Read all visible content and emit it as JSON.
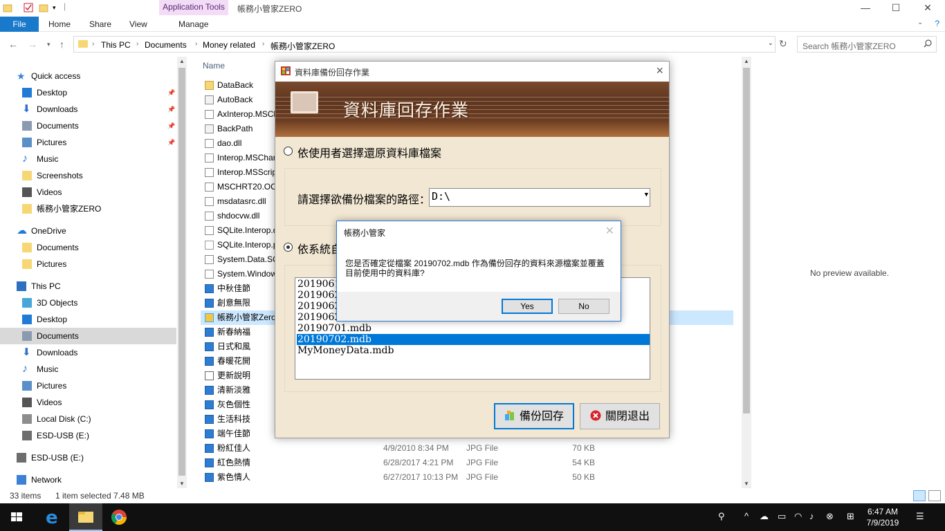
{
  "window": {
    "title": "帳務小管家ZERO",
    "app_tools": "Application Tools",
    "controls": {
      "minimize": "—",
      "maximize": "☐",
      "close": "✕"
    }
  },
  "ribbon": {
    "tabs": [
      "File",
      "Home",
      "Share",
      "View",
      "Manage"
    ]
  },
  "address": {
    "crumbs": [
      "This PC",
      "Documents",
      "Money related",
      "帳務小管家ZERO"
    ],
    "search_placeholder": "Search 帳務小管家ZERO"
  },
  "nav": {
    "items": [
      {
        "label": "Quick access",
        "icon": "star-icon",
        "pinned": false
      },
      {
        "label": "Desktop",
        "icon": "desktop-icon",
        "pinned": true
      },
      {
        "label": "Downloads",
        "icon": "download-icon",
        "pinned": true
      },
      {
        "label": "Documents",
        "icon": "documents-icon",
        "pinned": true
      },
      {
        "label": "Pictures",
        "icon": "pictures-icon",
        "pinned": true
      },
      {
        "label": "Music",
        "icon": "music-icon",
        "pinned": false
      },
      {
        "label": "Screenshots",
        "icon": "folder-icon",
        "pinned": false
      },
      {
        "label": "Videos",
        "icon": "videos-icon",
        "pinned": false
      },
      {
        "label": "帳務小管家ZERO",
        "icon": "folder-icon",
        "pinned": false
      },
      {
        "label": "OneDrive",
        "icon": "cloud-icon",
        "pinned": false
      },
      {
        "label": "Documents",
        "icon": "folder-icon",
        "pinned": false
      },
      {
        "label": "Pictures",
        "icon": "folder-icon",
        "pinned": false
      },
      {
        "label": "This PC",
        "icon": "computer-icon",
        "pinned": false
      },
      {
        "label": "3D Objects",
        "icon": "cube-icon",
        "pinned": false
      },
      {
        "label": "Desktop",
        "icon": "desktop-icon",
        "pinned": false
      },
      {
        "label": "Documents",
        "icon": "documents-icon",
        "pinned": false,
        "selected": true
      },
      {
        "label": "Downloads",
        "icon": "download-icon",
        "pinned": false
      },
      {
        "label": "Music",
        "icon": "music-icon",
        "pinned": false
      },
      {
        "label": "Pictures",
        "icon": "pictures-icon",
        "pinned": false
      },
      {
        "label": "Videos",
        "icon": "videos-icon",
        "pinned": false
      },
      {
        "label": "Local Disk (C:)",
        "icon": "drive-icon",
        "pinned": false
      },
      {
        "label": "ESD-USB (E:)",
        "icon": "usb-drive-icon",
        "pinned": false
      },
      {
        "label": "ESD-USB (E:)",
        "icon": "usb-drive-icon",
        "pinned": false
      },
      {
        "label": "Network",
        "icon": "network-icon",
        "pinned": false
      }
    ]
  },
  "list": {
    "column_name": "Name",
    "files": [
      {
        "name": "DataBack",
        "icon": "folder-icon",
        "date": "",
        "type": "",
        "size": ""
      },
      {
        "name": "AutoBack",
        "icon": "gear-file-icon",
        "date": "",
        "type": "",
        "size": ""
      },
      {
        "name": "AxInterop.MSCh",
        "icon": "dll-icon",
        "date": "",
        "type": "",
        "size": ""
      },
      {
        "name": "BackPath",
        "icon": "gear-file-icon",
        "date": "",
        "type": "",
        "size": ""
      },
      {
        "name": "dao.dll",
        "icon": "dll-icon",
        "date": "",
        "type": "",
        "size": ""
      },
      {
        "name": "Interop.MSChar",
        "icon": "dll-icon",
        "date": "",
        "type": "",
        "size": ""
      },
      {
        "name": "Interop.MSScrip",
        "icon": "dll-icon",
        "date": "",
        "type": "",
        "size": ""
      },
      {
        "name": "MSCHRT20.OCX",
        "icon": "dll-icon",
        "date": "",
        "type": "",
        "size": ""
      },
      {
        "name": "msdatasrc.dll",
        "icon": "dll-icon",
        "date": "",
        "type": "",
        "size": ""
      },
      {
        "name": "shdocvw.dll",
        "icon": "dll-icon",
        "date": "",
        "type": "",
        "size": ""
      },
      {
        "name": "SQLite.Interop.d",
        "icon": "dll-icon",
        "date": "",
        "type": "",
        "size": ""
      },
      {
        "name": "SQLite.Interop.p",
        "icon": "blank-file-icon",
        "date": "",
        "type": "",
        "size": ""
      },
      {
        "name": "System.Data.SQ",
        "icon": "dll-icon",
        "date": "",
        "type": "",
        "size": ""
      },
      {
        "name": "System.Window",
        "icon": "dll-icon",
        "date": "",
        "type": "",
        "size": ""
      },
      {
        "name": "中秋佳節",
        "icon": "image-file-icon",
        "date": "",
        "type": "",
        "size": ""
      },
      {
        "name": "創意無限",
        "icon": "image-file-icon",
        "date": "",
        "type": "",
        "size": ""
      },
      {
        "name": "帳務小管家Zero",
        "icon": "app-icon",
        "date": "",
        "type": "",
        "size": "",
        "selected": true
      },
      {
        "name": "新春納福",
        "icon": "image-file-icon",
        "date": "",
        "type": "",
        "size": ""
      },
      {
        "name": "日式和風",
        "icon": "image-file-icon",
        "date": "",
        "type": "",
        "size": ""
      },
      {
        "name": "春暖花開",
        "icon": "image-file-icon",
        "date": "",
        "type": "",
        "size": ""
      },
      {
        "name": "更新說明",
        "icon": "text-file-icon",
        "date": "",
        "type": "",
        "size": ""
      },
      {
        "name": "清新淡雅",
        "icon": "image-file-icon",
        "date": "",
        "type": "",
        "size": ""
      },
      {
        "name": "灰色個性",
        "icon": "image-file-icon",
        "date": "",
        "type": "",
        "size": ""
      },
      {
        "name": "生活科技",
        "icon": "image-file-icon",
        "date": "",
        "type": "",
        "size": ""
      },
      {
        "name": "端午佳節",
        "icon": "image-file-icon",
        "date": "",
        "type": "",
        "size": ""
      },
      {
        "name": "粉紅佳人",
        "icon": "image-file-icon",
        "date": "4/9/2010 8:34 PM",
        "type": "JPG File",
        "size": "70 KB"
      },
      {
        "name": "紅色熱情",
        "icon": "image-file-icon",
        "date": "6/28/2017 4:21 PM",
        "type": "JPG File",
        "size": "54 KB"
      },
      {
        "name": "紫色情人",
        "icon": "image-file-icon",
        "date": "6/27/2017 10:13 PM",
        "type": "JPG File",
        "size": "50 KB"
      }
    ]
  },
  "preview": {
    "text": "No preview available."
  },
  "status": {
    "count": "33 items",
    "selection": "1 item selected  7.48 MB"
  },
  "taskbar": {
    "time": "6:47 AM",
    "date": "7/9/2019"
  },
  "backup_dialog": {
    "title": "資料庫備份回存作業",
    "banner_title": "資料庫回存作業",
    "option1": "依使用者選擇還原資料庫檔案",
    "path_label": "請選擇欲備份檔案的路徑：",
    "path_value": "D:\\",
    "option2": "依系統自",
    "files": [
      "2019061",
      "2019062",
      "2019062",
      "2019062",
      "20190701.mdb",
      "20190702.mdb",
      "MyMoneyData.mdb"
    ],
    "selected_file": "20190702.mdb",
    "restore_button": "備份回存",
    "exit_button": "關閉退出"
  },
  "confirm_dialog": {
    "title": "帳務小管家",
    "message_line1": "您是否確定從檔案 20190702.mdb 作為備份回存的資料來源檔案並覆蓋",
    "message_line2": "目前使用中的資料庫?",
    "yes": "Yes",
    "no": "No"
  }
}
